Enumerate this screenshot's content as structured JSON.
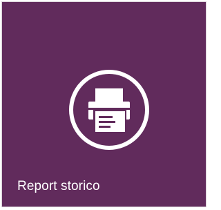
{
  "tile": {
    "label": "Report storico",
    "icon": "printer-icon",
    "background_color": "#612b5c",
    "foreground_color": "#ffffff"
  }
}
